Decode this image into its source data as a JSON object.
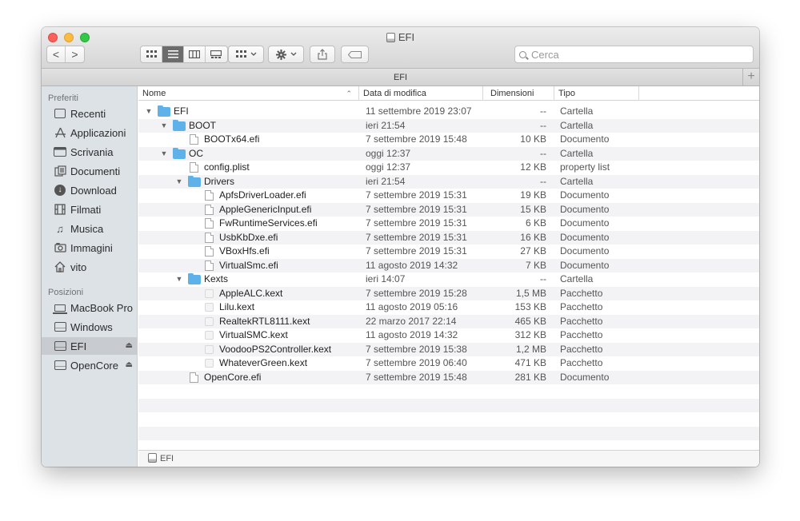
{
  "window": {
    "title": "EFI"
  },
  "toolbar": {
    "back": "<",
    "forward": ">",
    "search_placeholder": "Cerca"
  },
  "pathbar_top": {
    "label": "EFI",
    "add": "+"
  },
  "sidebar": {
    "heading_favorites": "Preferiti",
    "favorites": [
      {
        "label": "Recenti",
        "icon": "recents-icon"
      },
      {
        "label": "Applicazioni",
        "icon": "applications-icon"
      },
      {
        "label": "Scrivania",
        "icon": "desktop-icon"
      },
      {
        "label": "Documenti",
        "icon": "documents-icon"
      },
      {
        "label": "Download",
        "icon": "downloads-icon"
      },
      {
        "label": "Filmati",
        "icon": "movies-icon"
      },
      {
        "label": "Musica",
        "icon": "music-icon"
      },
      {
        "label": "Immagini",
        "icon": "pictures-icon"
      },
      {
        "label": "vito",
        "icon": "home-icon"
      }
    ],
    "heading_locations": "Posizioni",
    "locations": [
      {
        "label": "MacBook Pro",
        "icon": "laptop-icon"
      },
      {
        "label": "Windows",
        "icon": "drive-icon"
      },
      {
        "label": "EFI",
        "icon": "drive-icon",
        "selected": true,
        "eject": "⏏"
      },
      {
        "label": "OpenCore",
        "icon": "drive-icon",
        "eject": "⏏"
      }
    ]
  },
  "columns": {
    "name": "Nome",
    "date": "Data di modifica",
    "size": "Dimensioni",
    "kind": "Tipo"
  },
  "rows": [
    {
      "name": "EFI",
      "date": "11 settembre 2019 23:07",
      "size": "--",
      "kind": "Cartella",
      "depth": 0,
      "type": "folder",
      "open": true
    },
    {
      "name": "BOOT",
      "date": "ieri 21:54",
      "size": "--",
      "kind": "Cartella",
      "depth": 1,
      "type": "folder",
      "open": true
    },
    {
      "name": "BOOTx64.efi",
      "date": "7 settembre 2019 15:48",
      "size": "10 KB",
      "kind": "Documento",
      "depth": 2,
      "type": "doc"
    },
    {
      "name": "OC",
      "date": "oggi 12:37",
      "size": "--",
      "kind": "Cartella",
      "depth": 1,
      "type": "folder",
      "open": true
    },
    {
      "name": "config.plist",
      "date": "oggi 12:37",
      "size": "12 KB",
      "kind": "property list",
      "depth": 2,
      "type": "doc"
    },
    {
      "name": "Drivers",
      "date": "ieri 21:54",
      "size": "--",
      "kind": "Cartella",
      "depth": 2,
      "type": "folder",
      "open": true
    },
    {
      "name": "ApfsDriverLoader.efi",
      "date": "7 settembre 2019 15:31",
      "size": "19 KB",
      "kind": "Documento",
      "depth": 3,
      "type": "doc"
    },
    {
      "name": "AppleGenericInput.efi",
      "date": "7 settembre 2019 15:31",
      "size": "15 KB",
      "kind": "Documento",
      "depth": 3,
      "type": "doc"
    },
    {
      "name": "FwRuntimeServices.efi",
      "date": "7 settembre 2019 15:31",
      "size": "6 KB",
      "kind": "Documento",
      "depth": 3,
      "type": "doc"
    },
    {
      "name": "UsbKbDxe.efi",
      "date": "7 settembre 2019 15:31",
      "size": "16 KB",
      "kind": "Documento",
      "depth": 3,
      "type": "doc"
    },
    {
      "name": "VBoxHfs.efi",
      "date": "7 settembre 2019 15:31",
      "size": "27 KB",
      "kind": "Documento",
      "depth": 3,
      "type": "doc"
    },
    {
      "name": "VirtualSmc.efi",
      "date": "11 agosto 2019 14:32",
      "size": "7 KB",
      "kind": "Documento",
      "depth": 3,
      "type": "doc"
    },
    {
      "name": "Kexts",
      "date": "ieri 14:07",
      "size": "--",
      "kind": "Cartella",
      "depth": 2,
      "type": "folder",
      "open": true
    },
    {
      "name": "AppleALC.kext",
      "date": "7 settembre 2019 15:28",
      "size": "1,5 MB",
      "kind": "Pacchetto",
      "depth": 3,
      "type": "pkg"
    },
    {
      "name": "Lilu.kext",
      "date": "11 agosto 2019 05:16",
      "size": "153 KB",
      "kind": "Pacchetto",
      "depth": 3,
      "type": "pkg"
    },
    {
      "name": "RealtekRTL8111.kext",
      "date": "22 marzo 2017 22:14",
      "size": "465 KB",
      "kind": "Pacchetto",
      "depth": 3,
      "type": "pkg"
    },
    {
      "name": "VirtualSMC.kext",
      "date": "11 agosto 2019 14:32",
      "size": "312 KB",
      "kind": "Pacchetto",
      "depth": 3,
      "type": "pkg"
    },
    {
      "name": "VoodooPS2Controller.kext",
      "date": "7 settembre 2019 15:38",
      "size": "1,2 MB",
      "kind": "Pacchetto",
      "depth": 3,
      "type": "pkg"
    },
    {
      "name": "WhateverGreen.kext",
      "date": "7 settembre 2019 06:40",
      "size": "471 KB",
      "kind": "Pacchetto",
      "depth": 3,
      "type": "pkg"
    },
    {
      "name": "OpenCore.efi",
      "date": "7 settembre 2019 15:48",
      "size": "281 KB",
      "kind": "Documento",
      "depth": 2,
      "type": "doc"
    }
  ],
  "pathbar_bottom": {
    "label": "EFI"
  }
}
